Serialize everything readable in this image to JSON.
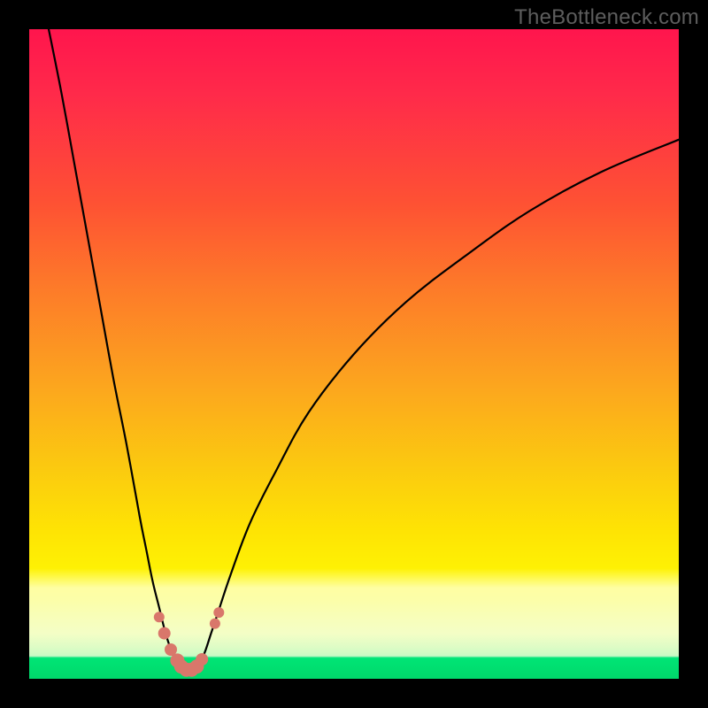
{
  "watermark": "TheBottleneck.com",
  "colors": {
    "frame": "#000000",
    "grad_top": "#FF154D",
    "grad_mid": "#FCA61E",
    "grad_low": "#FEF104",
    "grad_green": "#00E575",
    "curve": "#000000",
    "marker": "#D9776B"
  },
  "chart_data": {
    "type": "line",
    "title": "",
    "xlabel": "",
    "ylabel": "",
    "xlim": [
      0,
      100
    ],
    "ylim": [
      0,
      100
    ],
    "x_optimum": 24,
    "series": [
      {
        "name": "bottleneck-curve",
        "x": [
          3,
          5,
          7,
          9,
          11,
          13,
          15,
          17,
          18,
          19,
          20,
          21,
          22,
          23,
          24,
          25,
          26,
          27,
          28,
          29,
          31,
          34,
          38,
          43,
          50,
          58,
          67,
          77,
          88,
          100
        ],
        "y": [
          100,
          90,
          79,
          68,
          57,
          46,
          36,
          25,
          20,
          15,
          11,
          7,
          4,
          2,
          1,
          1,
          2,
          4,
          7,
          10,
          16,
          24,
          32,
          41,
          50,
          58,
          65,
          72,
          78,
          83
        ]
      }
    ],
    "markers": {
      "name": "highlight-points",
      "points": [
        {
          "x": 20.0,
          "y": 9.5,
          "r": 6
        },
        {
          "x": 20.8,
          "y": 7.0,
          "r": 7
        },
        {
          "x": 21.8,
          "y": 4.5,
          "r": 7
        },
        {
          "x": 22.8,
          "y": 2.8,
          "r": 8
        },
        {
          "x": 23.4,
          "y": 1.9,
          "r": 8
        },
        {
          "x": 24.2,
          "y": 1.4,
          "r": 8
        },
        {
          "x": 25.0,
          "y": 1.4,
          "r": 8
        },
        {
          "x": 25.8,
          "y": 1.9,
          "r": 8
        },
        {
          "x": 26.6,
          "y": 3.0,
          "r": 7
        },
        {
          "x": 28.6,
          "y": 8.5,
          "r": 6
        },
        {
          "x": 29.2,
          "y": 10.2,
          "r": 6
        }
      ]
    }
  }
}
